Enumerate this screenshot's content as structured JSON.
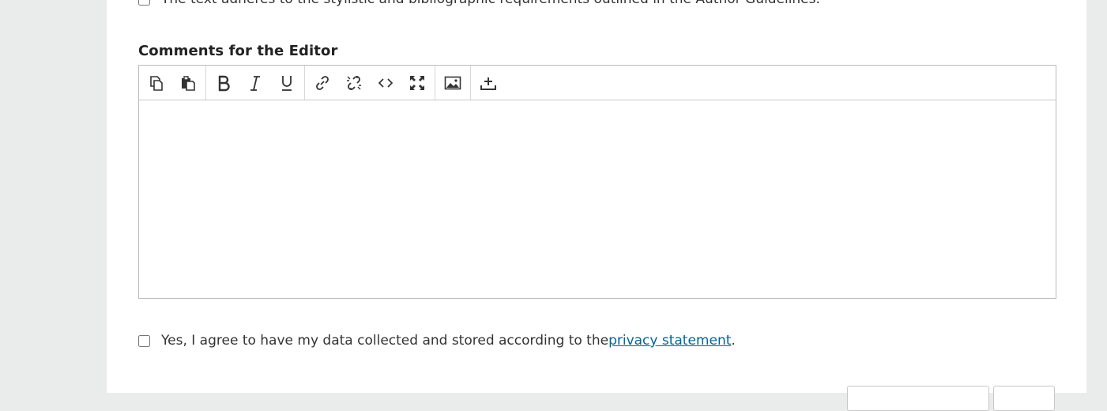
{
  "checklist": {
    "last_item_text": "The text adheres to the stylistic and bibliographic requirements outlined in the Author Guidelines."
  },
  "comments": {
    "label": "Comments for the Editor",
    "value": ""
  },
  "toolbar": {
    "buttons": [
      {
        "name": "copy-icon",
        "title": "Copy"
      },
      {
        "name": "paste-icon",
        "title": "Paste"
      },
      {
        "name": "bold-icon",
        "title": "Bold"
      },
      {
        "name": "italic-icon",
        "title": "Italic"
      },
      {
        "name": "underline-icon",
        "title": "Underline"
      },
      {
        "name": "link-icon",
        "title": "Insert/edit link"
      },
      {
        "name": "unlink-icon",
        "title": "Remove link"
      },
      {
        "name": "code-icon",
        "title": "Source code"
      },
      {
        "name": "fullscreen-icon",
        "title": "Fullscreen"
      },
      {
        "name": "image-icon",
        "title": "Insert/edit image"
      },
      {
        "name": "upload-icon",
        "title": "Upload"
      }
    ]
  },
  "privacy": {
    "text_before": "Yes, I agree to have my data collected and stored according to the ",
    "link_text": "privacy statement",
    "text_after": ".",
    "checked": false
  },
  "colors": {
    "link": "#006798",
    "page_bg": "#e9eceb",
    "panel_bg": "#ffffff"
  }
}
